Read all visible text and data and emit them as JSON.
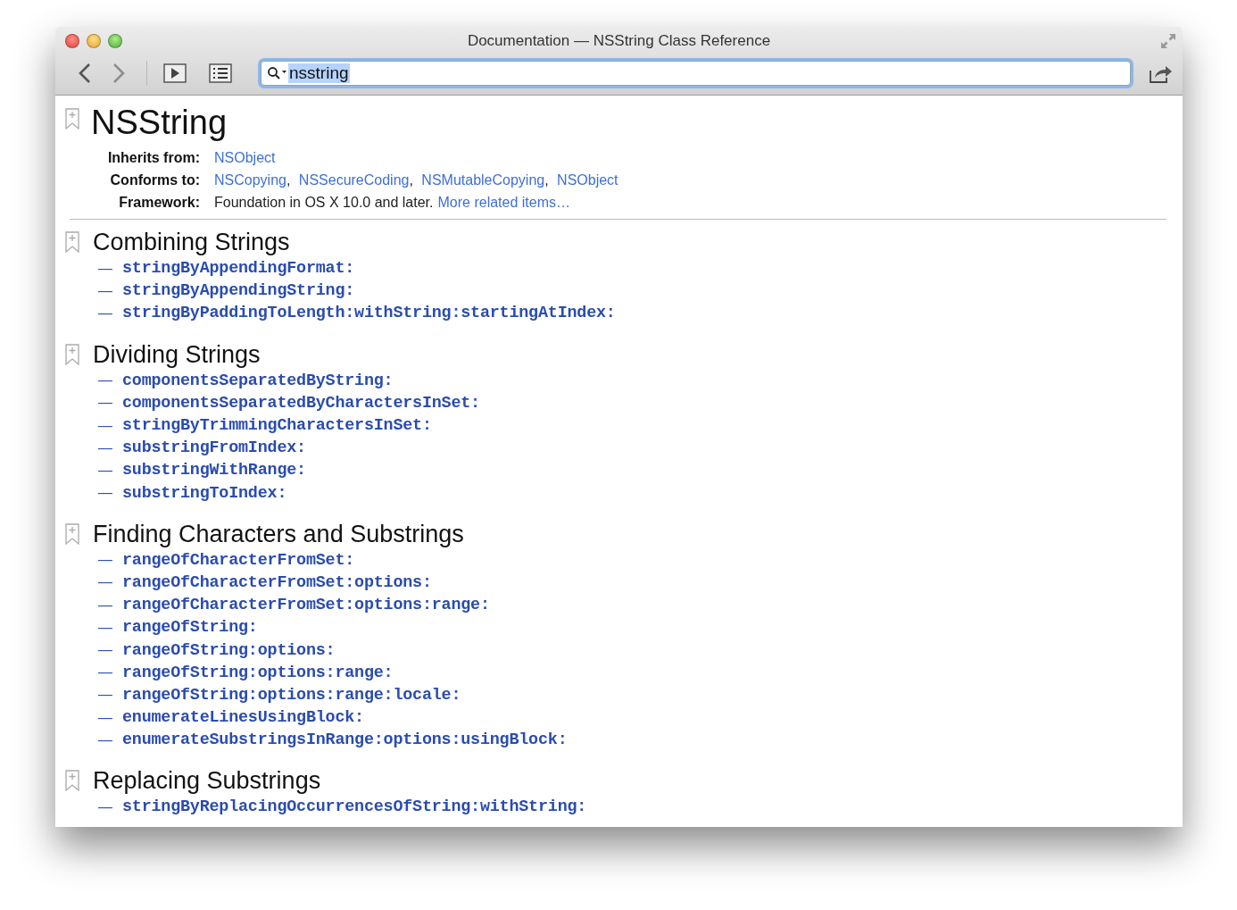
{
  "window": {
    "title": "Documentation — NSString Class Reference"
  },
  "search": {
    "value": "nsstring",
    "selected": true
  },
  "page": {
    "title": "NSString",
    "info": [
      {
        "label": "Inherits from:",
        "parts": [
          {
            "text": "NSObject",
            "kind": "link"
          }
        ]
      },
      {
        "label": "Conforms to:",
        "parts": [
          {
            "text": "NSCopying",
            "kind": "link"
          },
          {
            "text": ", ",
            "kind": "plain"
          },
          {
            "text": "NSSecureCoding",
            "kind": "link"
          },
          {
            "text": ", ",
            "kind": "plain"
          },
          {
            "text": "NSMutableCopying",
            "kind": "link"
          },
          {
            "text": ", ",
            "kind": "plain"
          },
          {
            "text": "NSObject",
            "kind": "link"
          }
        ]
      },
      {
        "label": "Framework:",
        "parts": [
          {
            "text": "Foundation in OS X 10.0 and later.",
            "kind": "plain"
          },
          {
            "text": "More related items…",
            "kind": "link"
          }
        ]
      }
    ],
    "sections": [
      {
        "title": "Combining Strings",
        "methods": [
          {
            "marker": "—",
            "name": "stringByAppendingFormat:"
          },
          {
            "marker": "—",
            "name": "stringByAppendingString:"
          },
          {
            "marker": "—",
            "name": "stringByPaddingToLength:withString:startingAtIndex:"
          }
        ]
      },
      {
        "title": "Dividing Strings",
        "methods": [
          {
            "marker": "—",
            "name": "componentsSeparatedByString:"
          },
          {
            "marker": "—",
            "name": "componentsSeparatedByCharactersInSet:"
          },
          {
            "marker": "—",
            "name": "stringByTrimmingCharactersInSet:"
          },
          {
            "marker": "—",
            "name": "substringFromIndex:"
          },
          {
            "marker": "—",
            "name": "substringWithRange:"
          },
          {
            "marker": "—",
            "name": "substringToIndex:"
          }
        ]
      },
      {
        "title": "Finding Characters and Substrings",
        "methods": [
          {
            "marker": "—",
            "name": "rangeOfCharacterFromSet:"
          },
          {
            "marker": "—",
            "name": "rangeOfCharacterFromSet:options:"
          },
          {
            "marker": "—",
            "name": "rangeOfCharacterFromSet:options:range:"
          },
          {
            "marker": "—",
            "name": "rangeOfString:"
          },
          {
            "marker": "—",
            "name": "rangeOfString:options:"
          },
          {
            "marker": "—",
            "name": "rangeOfString:options:range:"
          },
          {
            "marker": "—",
            "name": "rangeOfString:options:range:locale:"
          },
          {
            "marker": "—",
            "name": "enumerateLinesUsingBlock:"
          },
          {
            "marker": "—",
            "name": "enumerateSubstringsInRange:options:usingBlock:"
          }
        ]
      },
      {
        "title": "Replacing Substrings",
        "methods": [
          {
            "marker": "—",
            "name": "stringByReplacingOccurrencesOfString:withString:"
          }
        ]
      }
    ]
  }
}
